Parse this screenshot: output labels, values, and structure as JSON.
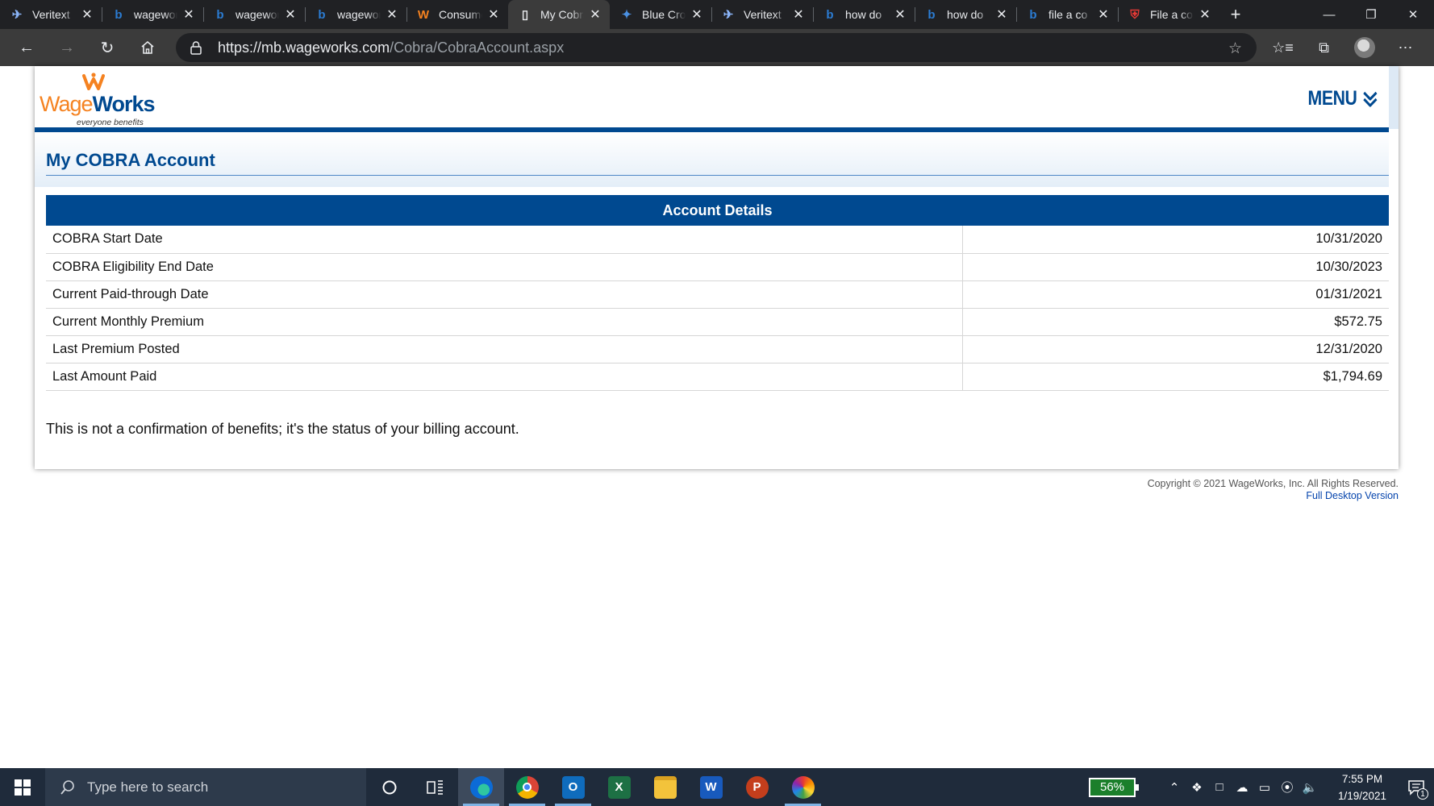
{
  "browser": {
    "tabs": [
      {
        "title": "Veritext",
        "icon": "veritext-icon",
        "active": false
      },
      {
        "title": "wageworks",
        "icon": "bing-icon",
        "active": false
      },
      {
        "title": "wageworks",
        "icon": "bing-icon",
        "active": false
      },
      {
        "title": "wageworks",
        "icon": "bing-icon",
        "active": false
      },
      {
        "title": "Consumer",
        "icon": "wageworks-icon",
        "active": false
      },
      {
        "title": "My Cobra",
        "icon": "page-icon",
        "active": true
      },
      {
        "title": "Blue Cross",
        "icon": "bluecross-icon",
        "active": false
      },
      {
        "title": "Veritext",
        "icon": "veritext-icon",
        "active": false
      },
      {
        "title": "how do",
        "icon": "bing-icon",
        "active": false
      },
      {
        "title": "how do",
        "icon": "bing-icon",
        "active": false
      },
      {
        "title": "file a co",
        "icon": "bing-icon",
        "active": false
      },
      {
        "title": "File a co",
        "icon": "shield-icon",
        "active": false
      }
    ],
    "url_host": "https://mb.wageworks.com",
    "url_path": "/Cobra/CobraAccount.aspx"
  },
  "page": {
    "logo": {
      "wage": "Wage",
      "works": "Works",
      "tagline": "everyone benefits"
    },
    "menu_label": "MENU",
    "title": "My COBRA Account",
    "details_header": "Account Details",
    "details": [
      {
        "label": "COBRA Start Date",
        "value": "10/31/2020"
      },
      {
        "label": "COBRA Eligibility End Date",
        "value": "10/30/2023"
      },
      {
        "label": "Current Paid-through Date",
        "value": "01/31/2021"
      },
      {
        "label": "Current Monthly Premium",
        "value": "$572.75"
      },
      {
        "label": "Last Premium Posted",
        "value": "12/31/2020"
      },
      {
        "label": "Last Amount Paid",
        "value": "$1,794.69"
      }
    ],
    "disclaimer": "This is not a confirmation of benefits; it's the status of your billing account.",
    "copyright": "Copyright © 2021 WageWorks, Inc. All Rights Reserved.",
    "full_desktop_link": "Full Desktop Version"
  },
  "taskbar": {
    "search_placeholder": "Type here to search",
    "battery_percent": "56%",
    "time": "7:55 PM",
    "date": "1/19/2021",
    "notification_count": "1"
  },
  "colors": {
    "brand_blue": "#004990",
    "brand_orange": "#f58220",
    "link": "#0645ad"
  }
}
